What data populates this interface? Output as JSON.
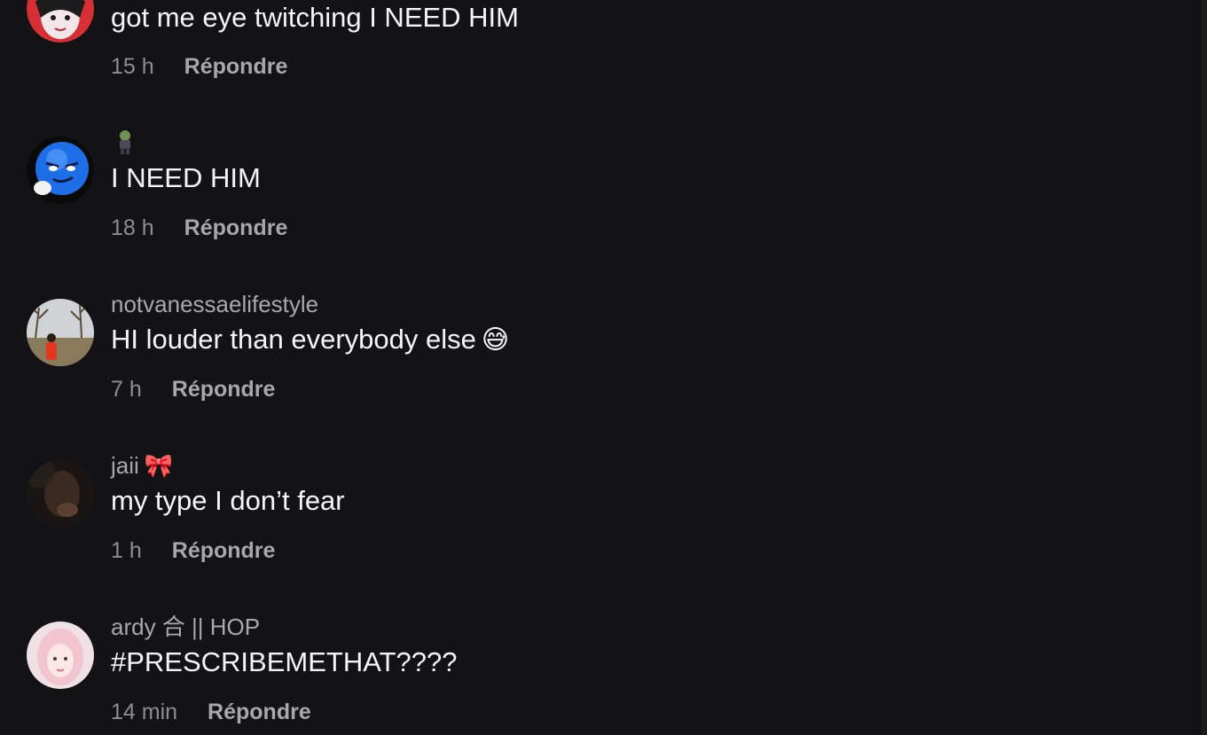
{
  "comments": [
    {
      "username": "",
      "text": "got me eye twitching I NEED HIM",
      "time": "15 h",
      "reply_label": "Répondre",
      "avatar_icon": "anime-girl-avatar"
    },
    {
      "username": "",
      "text": "I NEED HIM",
      "time": "18 h",
      "reply_label": "Répondre",
      "avatar_icon": "blue-smiley-avatar",
      "name_icon": "zombie-emoji"
    },
    {
      "username": "notvanessaelifestyle",
      "text": "HI louder than everybody else",
      "text_emoji": "😅",
      "time": "7 h",
      "reply_label": "Répondre",
      "avatar_icon": "outdoor-photo-avatar"
    },
    {
      "username": "jaii",
      "username_emoji": "🎀",
      "text": "my type I don’t fear",
      "time": "1 h",
      "reply_label": "Répondre",
      "avatar_icon": "dark-selfie-avatar"
    },
    {
      "username": "ardy 合 || HOP",
      "text": "#PRESCRIBEMETHAT????",
      "time": "14 min",
      "reply_label": "Répondre",
      "avatar_icon": "pink-hair-avatar"
    }
  ],
  "colors": {
    "background": "#131315",
    "primary_text": "#f5f5f5",
    "secondary_text": "#a8a8a8",
    "time_text": "#8e8e8e"
  }
}
